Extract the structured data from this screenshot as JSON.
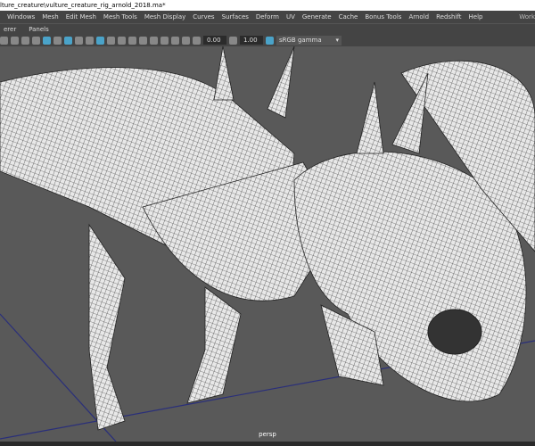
{
  "window": {
    "title": "lture_creature\\vulture_creature_rig_arnold_2018.ma*"
  },
  "menu": [
    "Windows",
    "Mesh",
    "Edit Mesh",
    "Mesh Tools",
    "Mesh Display",
    "Curves",
    "Surfaces",
    "Deform",
    "UV",
    "Generate",
    "Cache",
    "Bonus Tools",
    "Arnold",
    "Redshift",
    "Help"
  ],
  "workspace": "Work",
  "panels_menu": [
    "erer",
    "Panels"
  ],
  "toolbar": {
    "exposure": "0.00",
    "gamma": "1.00",
    "color_space": "sRGB gamma"
  },
  "viewport": {
    "camera": "persp"
  }
}
